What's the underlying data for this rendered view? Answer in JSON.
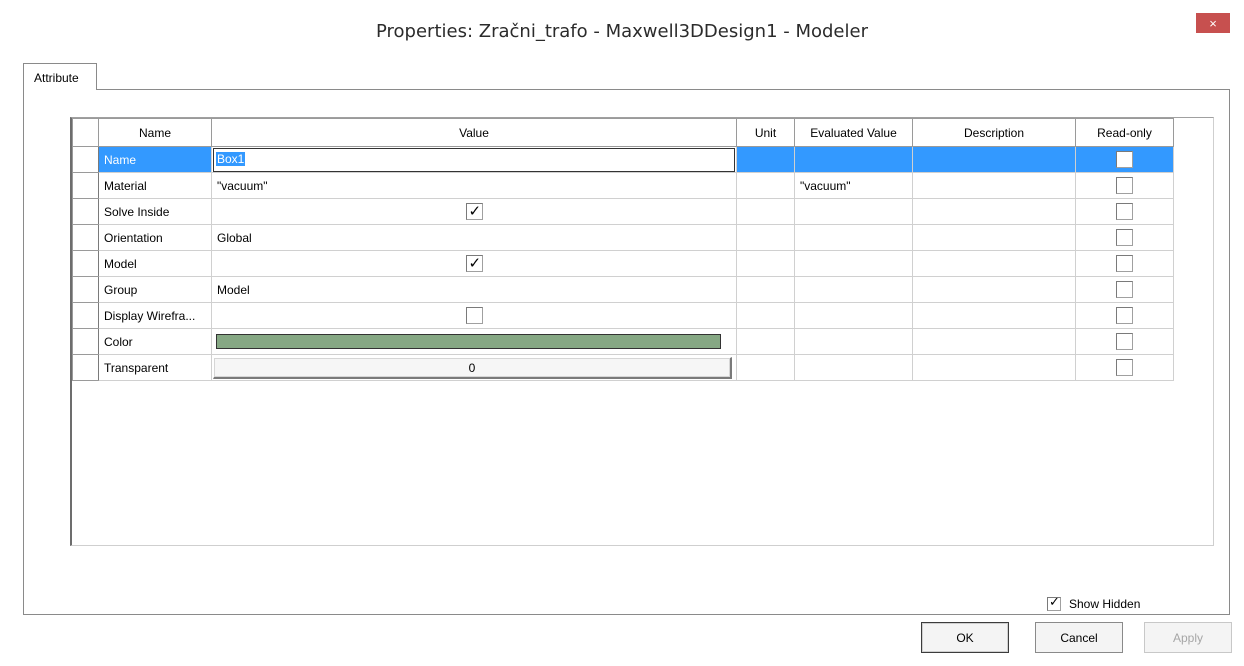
{
  "window": {
    "title": "Properties: Zračni_trafo - Maxwell3DDesign1 - Modeler",
    "close_glyph": "×"
  },
  "tabs": [
    {
      "label": "Attribute",
      "active": true
    }
  ],
  "grid": {
    "columns": [
      "Name",
      "Value",
      "Unit",
      "Evaluated Value",
      "Description",
      "Read-only"
    ],
    "rows": [
      {
        "name": "Name",
        "value": "Box1",
        "unit": "",
        "evaluated": "",
        "description": "",
        "read_only": false,
        "selected": true
      },
      {
        "name": "Material",
        "value": "\"vacuum\"",
        "unit": "",
        "evaluated": "\"vacuum\"",
        "description": "",
        "read_only": false
      },
      {
        "name": "Solve Inside",
        "value_checked": true,
        "unit": "",
        "evaluated": "",
        "description": "",
        "read_only": false
      },
      {
        "name": "Orientation",
        "value": "Global",
        "unit": "",
        "evaluated": "",
        "description": "",
        "read_only": false
      },
      {
        "name": "Model",
        "value_checked": true,
        "unit": "",
        "evaluated": "",
        "description": "",
        "read_only": false
      },
      {
        "name": "Group",
        "value": "Model",
        "unit": "",
        "evaluated": "",
        "description": "",
        "read_only": false
      },
      {
        "name": "Display Wirefra...",
        "value_checked": false,
        "unit": "",
        "evaluated": "",
        "description": "",
        "read_only": false
      },
      {
        "name": "Color",
        "color": "#86a884",
        "unit": "",
        "evaluated": "",
        "description": "",
        "read_only": false
      },
      {
        "name": "Transparent",
        "value": "0",
        "unit": "",
        "evaluated": "",
        "description": "",
        "read_only": false
      }
    ]
  },
  "options": {
    "show_hidden_label": "Show Hidden",
    "show_hidden_checked": true
  },
  "buttons": {
    "ok": "OK",
    "cancel": "Cancel",
    "apply": "Apply"
  },
  "colors": {
    "selection": "#3399ff",
    "close_button": "#c7504f",
    "object_color": "#86a884"
  },
  "icons": {
    "close": "close-icon",
    "checkbox": "checkmark-icon"
  }
}
